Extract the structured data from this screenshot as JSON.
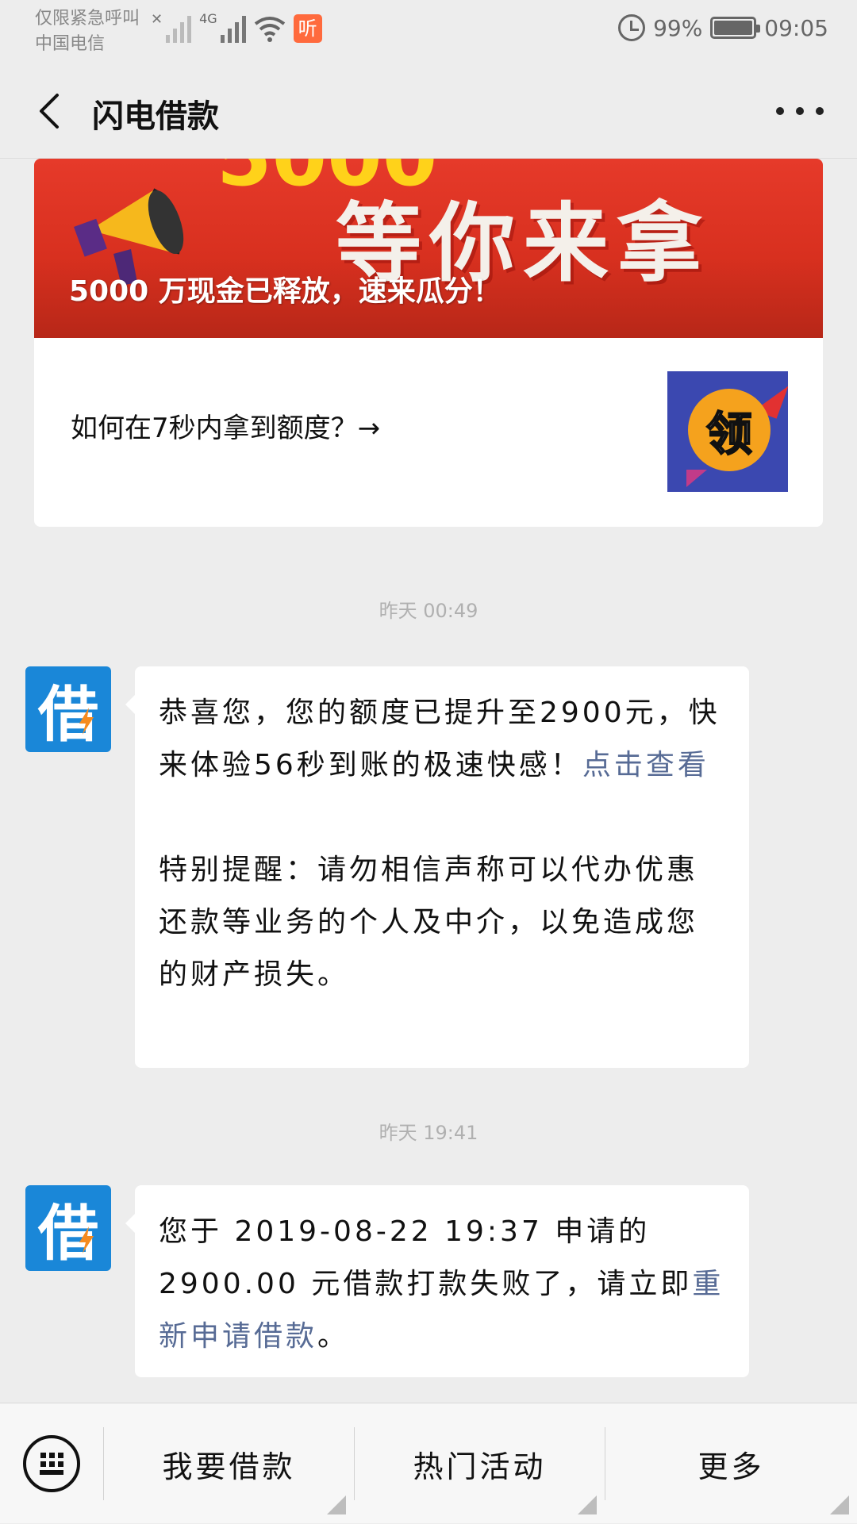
{
  "status_bar": {
    "carrier_line1": "仅限紧急呼叫",
    "carrier_line2": "中国电信",
    "network": "4G",
    "listen_badge": "听",
    "battery": "99%",
    "time": "09:05"
  },
  "header": {
    "title": "闪电借款"
  },
  "article": {
    "banner_top_text": "5000",
    "banner_big_text": "等你来拿",
    "banner_caption": "5000 万现金已释放，速来瓜分！",
    "sub_title": "如何在7秒内拿到额度？→",
    "thumb_glyph": "领"
  },
  "messages": [
    {
      "timestamp": "昨天 00:49",
      "avatar_glyph": "借",
      "text_a": "恭喜您，您的额度已提升至2900元，快来体验56秒到账的极速快感！",
      "link": "点击查看",
      "text_b": "特别提醒：请勿相信声称可以代办优惠还款等业务的个人及中介，以免造成您的财产损失。"
    },
    {
      "timestamp": "昨天 19:41",
      "avatar_glyph": "借",
      "text_a": "您于 2019-08-22 19:37 申请的 2900.00 元借款打款失败了，请立即",
      "link": "重新申请借款",
      "text_b": "。"
    }
  ],
  "bottom_menu": {
    "items": [
      "我要借款",
      "热门活动",
      "更多"
    ]
  },
  "colors": {
    "background": "#ededed",
    "link": "#576b95",
    "avatar": "#1a87d8",
    "banner": "#d8301f"
  }
}
